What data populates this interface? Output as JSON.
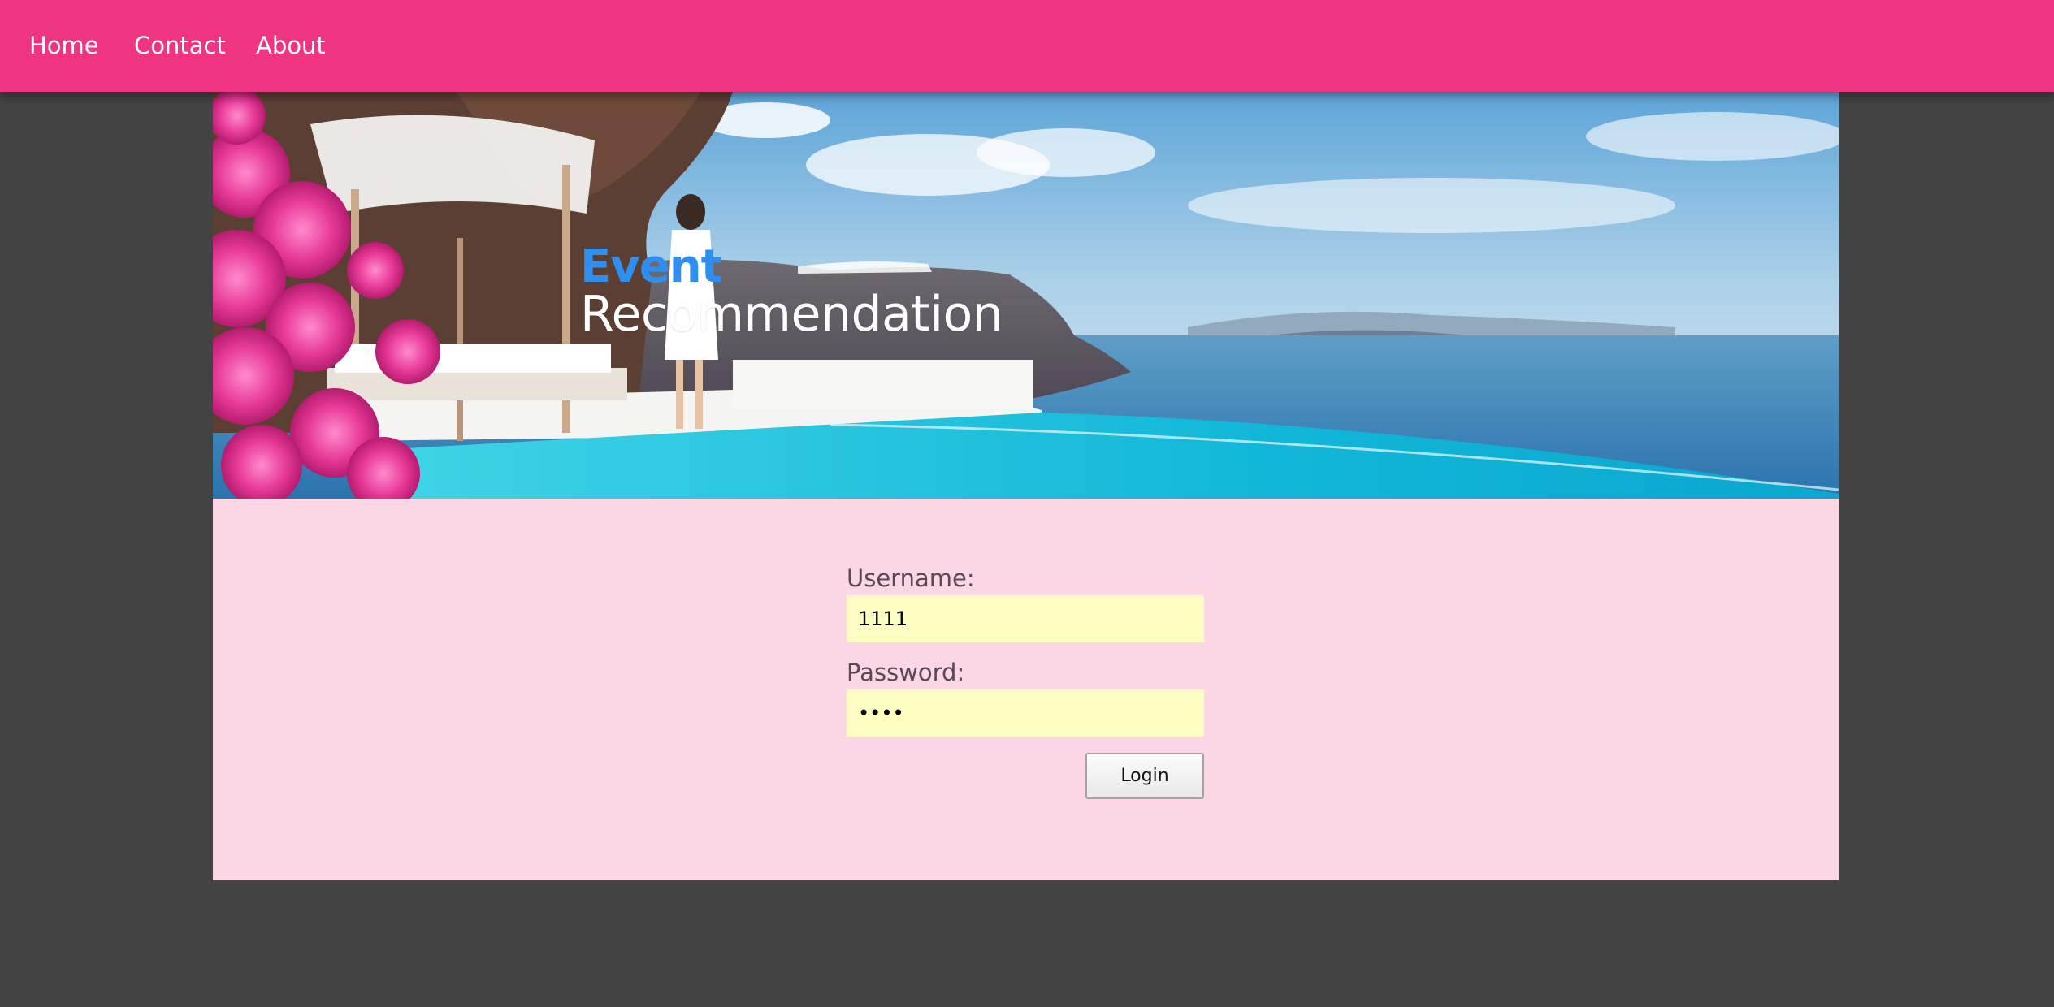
{
  "nav": {
    "items": [
      {
        "label": "Home"
      },
      {
        "label": "Contact"
      },
      {
        "label": "About"
      }
    ]
  },
  "hero": {
    "title_accent": "Event",
    "title_main": "Recommendation"
  },
  "login_form": {
    "username_label": "Username:",
    "username_value": "1111",
    "password_label": "Password:",
    "password_value": "1111",
    "login_label": "Login"
  },
  "colors": {
    "nav_bg": "#ef3581",
    "page_bg": "#434343",
    "panel_bg": "#fbd7e6",
    "input_bg": "#fbfdc1",
    "title_accent": "#2f8ff0"
  }
}
